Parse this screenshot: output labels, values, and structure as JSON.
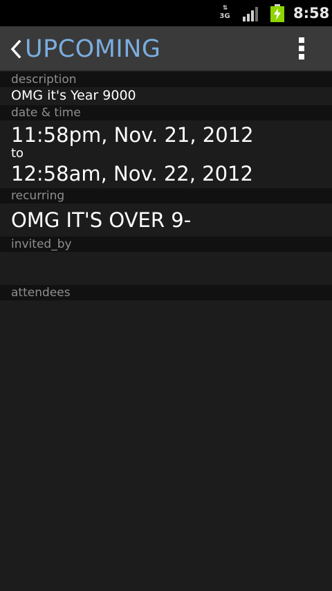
{
  "status_bar": {
    "network_type": "3G",
    "data_arrows": "⇅",
    "signal_icon": "signal-bars-icon",
    "battery_icon": "battery-charging-icon",
    "clock": "8:58",
    "battery_color": "#8fd400"
  },
  "action_bar": {
    "back_icon": "chevron-left-icon",
    "title": "UPCOMING",
    "title_color": "#7aaee0",
    "overflow_icon": "overflow-menu-icon"
  },
  "sections": {
    "description": {
      "label": "description",
      "value": "OMG it's Year 9000"
    },
    "date_time": {
      "label": "date & time",
      "start": "11:58pm, Nov. 21, 2012",
      "separator": "to",
      "end": "12:58am, Nov. 22, 2012"
    },
    "recurring": {
      "label": "recurring",
      "value": "OMG IT'S OVER 9-"
    },
    "invited_by": {
      "label": "invited_by",
      "value": ""
    },
    "attendees": {
      "label": "attendees"
    }
  }
}
